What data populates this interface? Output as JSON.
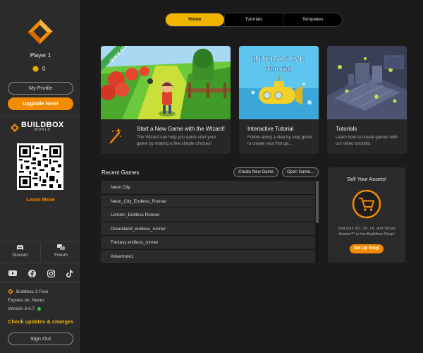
{
  "sidebar": {
    "player_name": "Player 1",
    "coins": "0",
    "my_profile": "My Profile",
    "upgrade": "Upgrade Now!",
    "buildbox_world_big": "BUILDBOX",
    "buildbox_world_small": "WORLD",
    "learn_more": "Learn More",
    "discord": "Discord",
    "forum": "Forum",
    "plan": "Buildbox 3 Free",
    "expires": "Expires on: Never",
    "version": "Version 3.4.7",
    "check_updates": "Check updates & changes",
    "sign_out": "Sign Out"
  },
  "tabs": [
    "Home",
    "Tutorials",
    "Templates"
  ],
  "cards": [
    {
      "title": "Start a New Game with the Wizard!",
      "desc": "The Wizard can help you quick-start your game by making a few simple choices!",
      "ribbon": "QUICK START!"
    },
    {
      "title": "Interactive Tutorial",
      "desc": "Follow along a step by step guide to create your first ga...",
      "img_text1": "INTERACTIVE",
      "img_text2": "Tutorial"
    },
    {
      "title": "Tutorials",
      "desc": "Learn how to create games with our video tutorials."
    }
  ],
  "recent": {
    "title": "Recent Games",
    "create_new": "Create New Game",
    "open_game": "Open Game...",
    "games": [
      "Neon City",
      "Neon_City_Endless_Runner",
      "London_Endless Runner",
      "Dreamland_endless_runner",
      "Fantasy endless_runner",
      "Adventure1"
    ]
  },
  "sell": {
    "title": "Sell Your Assets!",
    "desc": "Sell your 2D, 3D, UI, and Smart Assets™ in the Buildbox Shop!",
    "button": "Set Up Shop"
  },
  "colors": {
    "accent": "#f0b400",
    "orange": "#f28b00",
    "status_green": "#3ec43e"
  }
}
